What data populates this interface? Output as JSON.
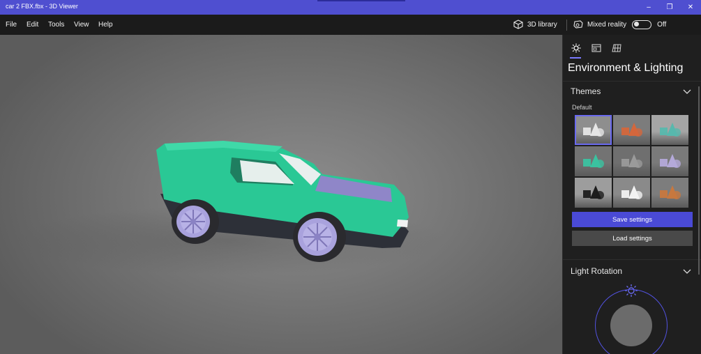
{
  "window": {
    "title": "car 2 FBX.fbx - 3D Viewer",
    "minimize_glyph": "–",
    "restore_glyph": "❐",
    "close_glyph": "✕",
    "accent_color": "#4f4fd0"
  },
  "menu": {
    "items": [
      "File",
      "Edit",
      "Tools",
      "View",
      "Help"
    ]
  },
  "toolbar": {
    "library_label": "3D library",
    "library_icon": "cube-icon",
    "mixed_reality_label": "Mixed reality",
    "mixed_reality_icon": "headset-icon",
    "toggle_state": "Off"
  },
  "panel": {
    "tabs": [
      {
        "name": "environment-lighting",
        "icon": "sun-icon",
        "active": true
      },
      {
        "name": "stats-shading",
        "icon": "display-icon",
        "active": false
      },
      {
        "name": "grid-views",
        "icon": "grid-icon",
        "active": false
      }
    ],
    "heading": "Environment & Lighting",
    "themes": {
      "title": "Themes",
      "selected_label": "Default",
      "items": [
        {
          "name": "theme-white",
          "bg": "#8e8e8e",
          "fg": "#e6e6e6",
          "selected": true
        },
        {
          "name": "theme-orange",
          "bg": "#7c7c7c",
          "fg": "#d4673c",
          "selected": false
        },
        {
          "name": "theme-teal",
          "bg": "#a5a5a5",
          "fg": "#57b8ad",
          "selected": false
        },
        {
          "name": "theme-green",
          "bg": "#737373",
          "fg": "#3bc2a0",
          "selected": false
        },
        {
          "name": "theme-gray",
          "bg": "#6f6f6f",
          "fg": "#9a9a9a",
          "selected": false
        },
        {
          "name": "theme-lavender",
          "bg": "#7a7a7a",
          "fg": "#b4a9d9",
          "selected": false
        },
        {
          "name": "theme-dark",
          "bg": "#9d9d9d",
          "fg": "#1d1d1d",
          "selected": false
        },
        {
          "name": "theme-bright",
          "bg": "#8a8a8a",
          "fg": "#f2f2f2",
          "selected": false
        },
        {
          "name": "theme-sunset",
          "bg": "#7d7d7d",
          "fg": "#c7783f",
          "selected": false
        }
      ]
    },
    "save_label": "Save settings",
    "load_label": "Load settings",
    "light_rotation_title": "Light Rotation"
  },
  "colors": {
    "car_body": "#2ac895",
    "car_lower": "#2d3038",
    "wheel_rim": "#a9a2dd",
    "windshield": "#8f86c8",
    "button_primary": "#4a4ad6"
  }
}
